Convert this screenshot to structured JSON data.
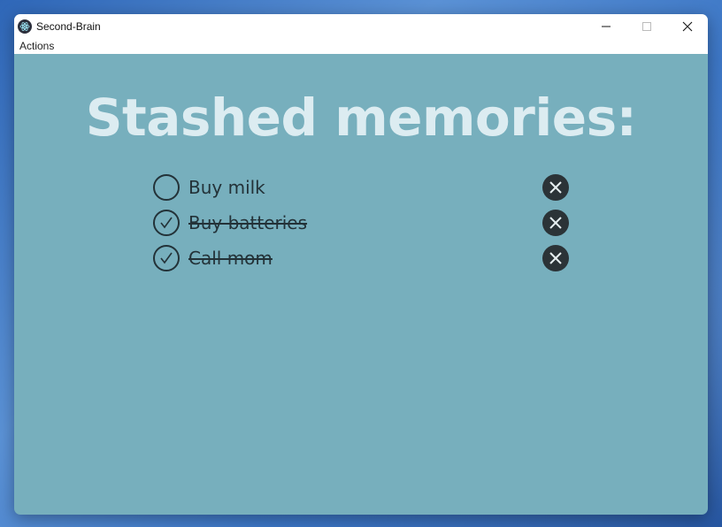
{
  "window": {
    "title": "Second-Brain"
  },
  "menu": {
    "items": [
      {
        "label": "Actions"
      }
    ]
  },
  "main": {
    "heading": "Stashed memories:",
    "todos": [
      {
        "text": "Buy milk",
        "done": false
      },
      {
        "text": "Buy batteries",
        "done": true
      },
      {
        "text": "Call mom",
        "done": true
      }
    ]
  },
  "icons": {
    "app": "electron-icon",
    "unchecked": "circle-icon",
    "checked": "checkmark-circle-icon",
    "delete": "close-circle-icon",
    "minimize": "minimize-icon",
    "maximize": "maximize-icon",
    "close": "close-icon"
  },
  "colors": {
    "window_bg": "#77afbd",
    "heading": "#dcecf1",
    "text": "#233238",
    "delete_bg": "#2b3337"
  }
}
